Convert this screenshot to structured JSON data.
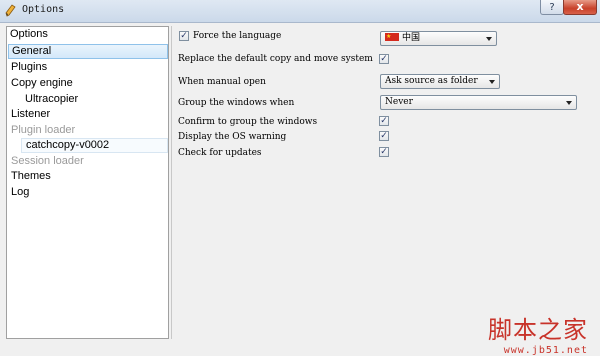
{
  "window": {
    "title": "Options",
    "help_label": "?",
    "close_label": "x"
  },
  "sidebar": {
    "header": "Options",
    "items": [
      {
        "label": "General"
      },
      {
        "label": "Plugins"
      },
      {
        "label": "Copy engine"
      },
      {
        "label": "Ultracopier"
      },
      {
        "label": "Listener"
      },
      {
        "label": "Plugin loader"
      },
      {
        "label": "catchcopy-v0002"
      },
      {
        "label": "Session loader"
      },
      {
        "label": "Themes"
      },
      {
        "label": "Log"
      }
    ]
  },
  "general": {
    "force_language": {
      "label": "Force the language",
      "checked": true,
      "value": "中国"
    },
    "replace_copy_move": {
      "label": "Replace the default copy and move system",
      "checked": true
    },
    "manual_open": {
      "label": "When manual open",
      "value": "Ask source as folder"
    },
    "group_windows": {
      "label": "Group the windows when",
      "value": "Never"
    },
    "confirm_group": {
      "label": "Confirm to group the windows",
      "checked": true
    },
    "os_warning": {
      "label": "Display the OS warning",
      "checked": true
    },
    "check_updates": {
      "label": "Check for updates",
      "checked": true
    }
  },
  "check_glyph": "✓",
  "watermark": {
    "line1": "脚本之家",
    "line2": "www.jb51.net"
  },
  "colors": {
    "flag_red": "#d42a1e",
    "selection": "#d3e8fa",
    "watermark": "#c8332a"
  },
  "icons": {
    "app": "pencil-icon",
    "flag": "china-flag-icon"
  }
}
